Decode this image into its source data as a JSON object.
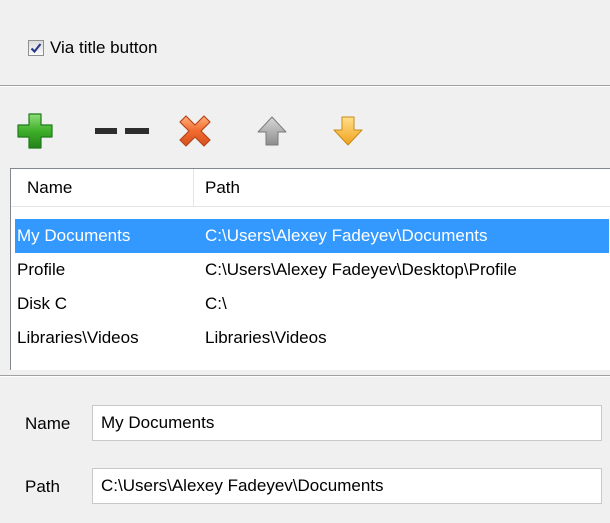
{
  "options": {
    "via_title_button": {
      "label": "Via title button",
      "checked": true
    }
  },
  "toolbar": {
    "buttons": [
      {
        "name": "add",
        "icon": "plus-icon",
        "color": "#3fae29"
      },
      {
        "name": "separator",
        "icon": "separator-icon",
        "color": "#333333"
      },
      {
        "name": "delete",
        "icon": "close-icon",
        "color": "#f07030"
      },
      {
        "name": "move-up",
        "icon": "arrow-up-icon",
        "color": "#a0a0a0"
      },
      {
        "name": "move-down",
        "icon": "arrow-down-icon",
        "color": "#f5a623"
      }
    ]
  },
  "list": {
    "columns": [
      "Name",
      "Path"
    ],
    "rows": [
      {
        "name": "My Documents",
        "path": "C:\\Users\\Alexey Fadeyev\\Documents",
        "selected": true
      },
      {
        "name": "Profile",
        "path": "C:\\Users\\Alexey Fadeyev\\Desktop\\Profile",
        "selected": false
      },
      {
        "name": "Disk C",
        "path": "C:\\",
        "selected": false
      },
      {
        "name": "Libraries\\Videos",
        "path": "Libraries\\Videos",
        "selected": false
      }
    ],
    "selection_color": "#3399ff"
  },
  "form": {
    "name_label": "Name",
    "name_value": "My Documents",
    "path_label": "Path",
    "path_value": "C:\\Users\\Alexey Fadeyev\\Documents"
  }
}
